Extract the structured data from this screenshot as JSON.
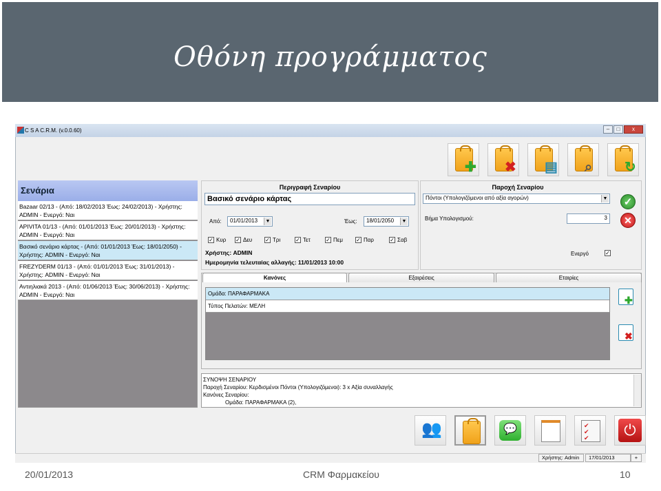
{
  "slide": {
    "title": "Οθόνη προγράμματος",
    "footer_date": "20/01/2013",
    "footer_center": "CRM Φαρμακείου",
    "footer_page": "10"
  },
  "app": {
    "window_title": "C S A C.R.M.  (v.0.0.60)",
    "toolbar_icons": [
      "add-scenario-icon",
      "delete-scenario-icon",
      "copy-scenario-icon",
      "search-scenario-icon",
      "refresh-scenario-icon"
    ],
    "bottom_icons": [
      "customers-icon",
      "scenarios-icon",
      "messages-icon",
      "contacts-icon",
      "checklist-icon",
      "power-icon"
    ]
  },
  "scenarios": {
    "header": "Σενάρια",
    "items": [
      {
        "line1": "Bazaar 02/13 - (Από: 18/02/2013 Έως: 24/02/2013) - Χρήστης:",
        "line2": "ADMIN - Ενεργό: Ναι"
      },
      {
        "line1": "APIVITA 01/13 - (Από: 01/01/2013 Έως: 20/01/2013) - Χρήστης:",
        "line2": "ADMIN - Ενεργό: Ναι"
      },
      {
        "line1": "Βασικό σενάριο κάρτας - (Από: 01/01/2013 Έως: 18/01/2050) -",
        "line2": "Χρήστης: ADMIN - Ενεργό: Ναι"
      },
      {
        "line1": "FREZYDERM 01/13 - (Από: 01/01/2013 Έως: 31/01/2013) -",
        "line2": "Χρήστης: ADMIN - Ενεργό: Ναι"
      },
      {
        "line1": "Αντιηλιακά 2013 - (Από: 01/06/2013 Έως: 30/06/2013) - Χρήστης:",
        "line2": "ADMIN - Ενεργό: Ναι"
      }
    ]
  },
  "description": {
    "section_label": "Περιγραφή Σεναρίου",
    "name": "Βασικό σενάριο κάρτας",
    "from_label": "Από:",
    "from_value": "01/01/2013",
    "to_label": "Έως:",
    "to_value": "18/01/2050",
    "days": [
      "Κυρ",
      "Δευ",
      "Τρι",
      "Τετ",
      "Πεμ",
      "Παρ",
      "Σαβ"
    ],
    "user_line": "Χρήστης: ADMIN",
    "last_change_line": "Ημερομηνία τελευταίας αλλαγής: 11/01/2013 10:00"
  },
  "provision": {
    "section_label": "Παροχή Σεναρίου",
    "type_value": "Πόντοι (Υπολογιζόμενοι από αξία αγορών)",
    "step_label": "Βήμα Υπολογισμού:",
    "step_value": "3",
    "active_label": "Ενεργό"
  },
  "tabs": [
    "Κανόνες",
    "Εξαιρέσεις",
    "Εταιρίες"
  ],
  "rules": [
    "Ομάδα: ΠΑΡΑΦΑΡΜΑΚΑ",
    "Τύπος Πελατών: ΜΕΛΗ"
  ],
  "summary": {
    "lines": [
      "ΣΥΝΟΨΗ ΣΕΝΑΡΙΟΥ",
      "Παροχή Σεναρίου: Κερδισμένοι Πόντοι (Υπολογιζόμενοι): 3 x Αξία συναλλαγής",
      "Κανόνες Σεναρίου:",
      "Ομάδα: ΠΑΡΑΦΑΡΜΑΚΑ (2),"
    ]
  },
  "status": {
    "user": "Χρήστης: Admin",
    "date": "17/01/2013"
  }
}
